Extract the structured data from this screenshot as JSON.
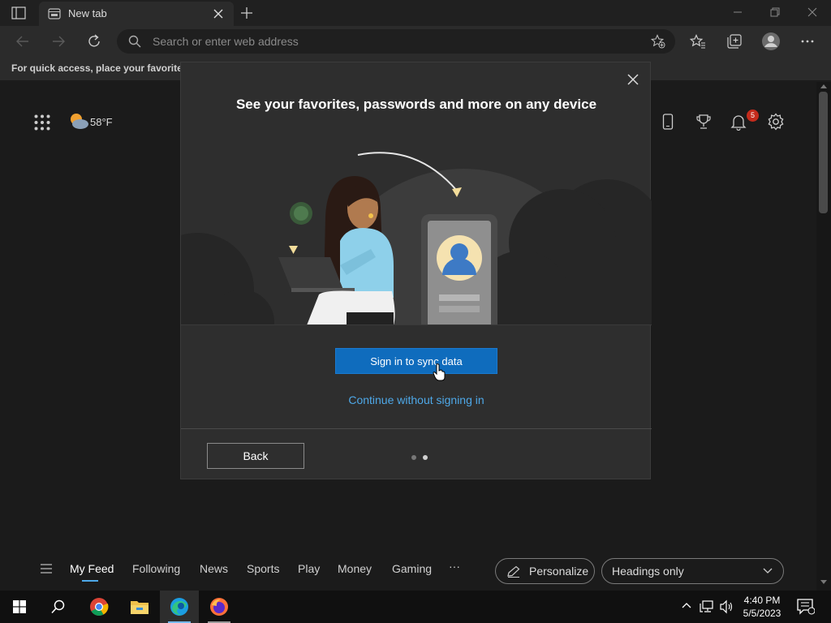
{
  "browser": {
    "tab_title": "New tab",
    "address_placeholder": "Search or enter web address",
    "favorites_bar_text": "For quick access, place your favorites h"
  },
  "newtab": {
    "weather_temp": "58°F",
    "notification_count": "5",
    "feed_nav": [
      "My Feed",
      "Following",
      "News",
      "Sports",
      "Play",
      "Money",
      "Gaming",
      "···"
    ],
    "personalize_label": "Personalize",
    "headings_select_value": "Headings only"
  },
  "dialog": {
    "title": "See your favorites, passwords and more on any device",
    "primary_button": "Sign in to sync data",
    "secondary_link": "Continue without signing in",
    "back_button": "Back",
    "page_indicator": {
      "total": 2,
      "current": 2
    }
  },
  "taskbar": {
    "time": "4:40 PM",
    "date": "5/5/2023"
  },
  "colors": {
    "accent": "#0f6cbd",
    "link": "#4ea8e8",
    "badge": "#c42b1c"
  }
}
